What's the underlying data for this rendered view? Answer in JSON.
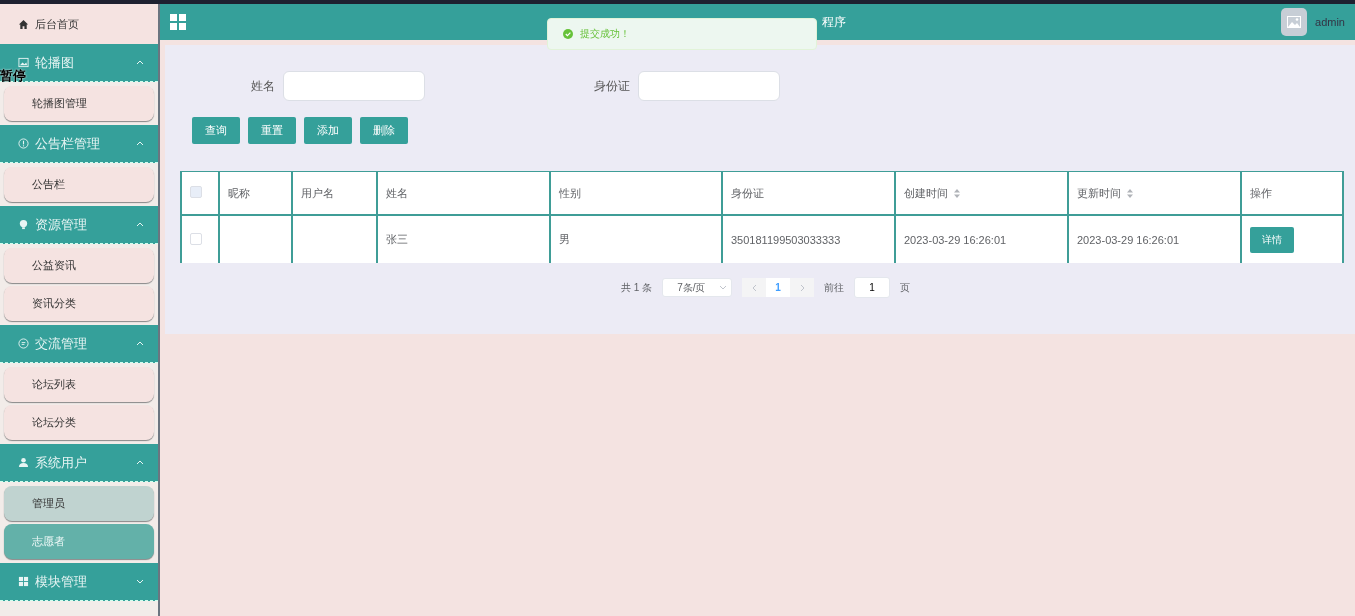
{
  "overlay_label": "暂停",
  "sidebar": {
    "home": {
      "label": "后台首页"
    },
    "groups": [
      {
        "kind": "image",
        "label": "轮播图",
        "expanded": true,
        "items": [
          {
            "label": "轮播图管理",
            "selected": false,
            "hovered": false
          }
        ]
      },
      {
        "kind": "info",
        "label": "公告栏管理",
        "expanded": true,
        "items": [
          {
            "label": "公告栏",
            "selected": false,
            "hovered": false
          }
        ]
      },
      {
        "kind": "bulb",
        "label": "资源管理",
        "expanded": true,
        "items": [
          {
            "label": "公益资讯",
            "selected": false,
            "hovered": false
          },
          {
            "label": "资讯分类",
            "selected": false,
            "hovered": false
          }
        ]
      },
      {
        "kind": "chat",
        "label": "交流管理",
        "expanded": true,
        "items": [
          {
            "label": "论坛列表",
            "selected": false,
            "hovered": false
          },
          {
            "label": "论坛分类",
            "selected": false,
            "hovered": false
          }
        ]
      },
      {
        "kind": "user",
        "label": "系统用户",
        "expanded": true,
        "items": [
          {
            "label": "管理员",
            "selected": false,
            "hovered": true
          },
          {
            "label": "志愿者",
            "selected": true,
            "hovered": false
          }
        ]
      },
      {
        "kind": "grid",
        "label": "模块管理",
        "expanded": false
      }
    ]
  },
  "header": {
    "title": "程序",
    "user": "admin"
  },
  "toast": {
    "message": "提交成功！"
  },
  "search": {
    "fields": [
      {
        "label": "姓名"
      },
      {
        "label": "身份证"
      }
    ],
    "buttons": [
      "查询",
      "重置",
      "添加",
      "删除"
    ]
  },
  "table": {
    "columns": [
      {
        "label": "昵称",
        "sortable": false
      },
      {
        "label": "用户名",
        "sortable": false
      },
      {
        "label": "姓名",
        "sortable": false
      },
      {
        "label": "性别",
        "sortable": false
      },
      {
        "label": "身份证",
        "sortable": false
      },
      {
        "label": "创建时间",
        "sortable": true
      },
      {
        "label": "更新时间",
        "sortable": true
      },
      {
        "label": "操作",
        "sortable": false
      }
    ],
    "rows": [
      {
        "checked": false,
        "cells": [
          "",
          "",
          "张三",
          "男",
          "350181199503033333",
          "2023-03-29 16:26:01",
          "2023-03-29 16:26:01"
        ],
        "action": "详情"
      }
    ],
    "header_checked": false
  },
  "pagination": {
    "total": "共 1 条",
    "page_size": "7条/页",
    "pages": [
      {
        "label": "1",
        "selected": true
      }
    ],
    "goto_label": "前往",
    "goto_value": "1",
    "goto_suffix": "页"
  }
}
